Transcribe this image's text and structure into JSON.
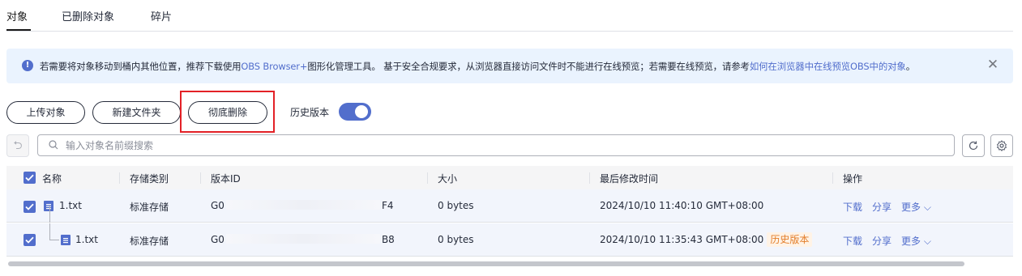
{
  "tabs": [
    {
      "label": "对象",
      "active": true
    },
    {
      "label": "已删除对象",
      "active": false
    },
    {
      "label": "碎片",
      "active": false
    }
  ],
  "banner": {
    "text_before": "若需要将对象移动到桶内其他位置，推荐下载使用",
    "link1": "OBS Browser+",
    "text_middle": "图形化管理工具。 基于安全合规要求，从浏览器直接访问文件时不能进行在线预览；若需要在线预览，请参考",
    "link2": "如何在浏览器中在线预览OBS中的对象",
    "text_after": "。",
    "info_icon": "info-icon",
    "close_icon": "close-icon"
  },
  "toolbar": {
    "upload_label": "上传对象",
    "new_folder_label": "新建文件夹",
    "permanent_delete_label": "彻底删除",
    "history_label": "历史版本",
    "history_enabled": true
  },
  "search": {
    "placeholder": "输入对象名前缀搜索",
    "value": ""
  },
  "table": {
    "columns": [
      "名称",
      "存储类别",
      "版本ID",
      "大小",
      "最后修改时间",
      "操作"
    ],
    "rows": [
      {
        "name": "1.txt",
        "storage_class": "标准存储",
        "version_id_prefix": "G0",
        "version_id_suffix": "F4",
        "size": "0 bytes",
        "modified": "2024/10/10 11:40:10 GMT+08:00",
        "badge": "",
        "checked": true,
        "actions": {
          "download": "下载",
          "share": "分享",
          "more": "更多"
        }
      },
      {
        "name": "1.txt",
        "storage_class": "标准存储",
        "version_id_prefix": "G0",
        "version_id_suffix": "B8",
        "size": "0 bytes",
        "modified": "2024/10/10 11:35:43 GMT+08:00",
        "badge": "历史版本",
        "checked": true,
        "actions": {
          "download": "下载",
          "share": "分享",
          "more": "更多"
        }
      }
    ]
  },
  "colors": {
    "accent": "#526ecc",
    "highlight_box": "#e32127",
    "badge_text": "#e37d29",
    "banner_bg": "#eaf3fe"
  }
}
